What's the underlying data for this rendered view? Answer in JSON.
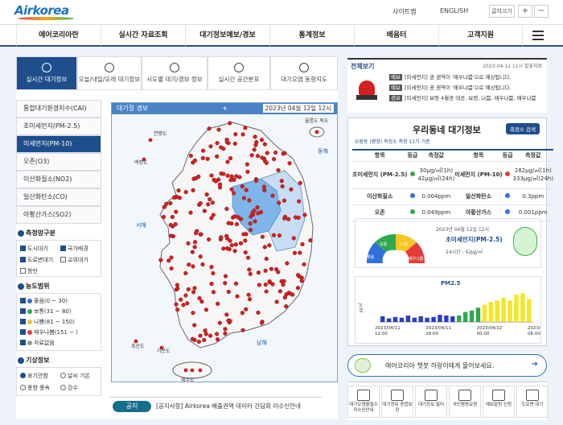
{
  "header": {
    "logo": "Airkorea",
    "sitemap": "사이트맵",
    "english": "ENGLISH",
    "font_size": "글자크기",
    "zoom_in": "+",
    "zoom_out": "−"
  },
  "nav": {
    "items": [
      "에어코리아란",
      "실시간 자료조회",
      "대기정보예보/경보",
      "통계정보",
      "배움터",
      "고객지원"
    ]
  },
  "tabs": [
    "실시간 대기정보",
    "오늘/내일/모레 대기정보",
    "시도별 대기/경보 정보",
    "실시간 공간분포",
    "대기오염 동향지도"
  ],
  "pollutants": [
    "통합대기환경지수(CAI)",
    "초미세먼지(PM-2.5)",
    "미세먼지(PM-10)",
    "오존(O3)",
    "이산화질소(NO2)",
    "일산화탄소(CO)",
    "아황산가스(SO2)"
  ],
  "pollutant_selected": 2,
  "station_type": {
    "title": "측정망구분",
    "items": [
      {
        "label": "도시대기",
        "checked": true
      },
      {
        "label": "국가배경",
        "checked": true
      },
      {
        "label": "도로변대기",
        "checked": true
      },
      {
        "label": "교외대기",
        "checked": false
      },
      {
        "label": "항만",
        "checked": false
      }
    ]
  },
  "concentration": {
    "title": "농도범위",
    "items": [
      {
        "label": "좋음(0 ~ 30)",
        "color": "#2f6fdc"
      },
      {
        "label": "보통(31 ~ 80)",
        "color": "#2fa84f"
      },
      {
        "label": "나쁨(81 ~ 150)",
        "color": "#f6c623"
      },
      {
        "label": "매우나쁨(151 ~ )",
        "color": "#e53b3b"
      },
      {
        "label": "자료없음",
        "color": "#999999"
      }
    ]
  },
  "weather": {
    "title": "기상정보",
    "items": [
      {
        "label": "표기안함",
        "checked": true
      },
      {
        "label": "날씨 기온",
        "checked": false
      },
      {
        "label": "풍향 풍속",
        "checked": false
      },
      {
        "label": "강수",
        "checked": false
      }
    ]
  },
  "map": {
    "title": "대기질 경보",
    "plus": "+",
    "datetime": "2023년 04월 12일 12시",
    "labels": {
      "yeonpyeong": "연평도",
      "baengnyeong": "백령도",
      "ulleung": "울릉도 독도",
      "donghae": "동해",
      "seohae": "서해",
      "namhae": "남해",
      "jeju": "제주도",
      "heuksan": "흑산도",
      "geomundo": "거문도"
    }
  },
  "notice": {
    "button": "공지",
    "text": "[공지사항]  Airkorea 배출권역 데이터 간담회 미수신안내"
  },
  "news": {
    "title": "전체보기",
    "time": "2023-04-12 11시 발표자료",
    "items": [
      {
        "tag": "예보",
        "text": "[미세먼지] 권 권역이 '매우나쁨'으로 예상됩니다."
      },
      {
        "tag": "예보",
        "text": "[미세먼지] 권 권역이 '매우나쁨'으로 예상됩니다."
      },
      {
        "tag": "경보",
        "text": "[미세먼지] 보령 4월경 대응, 보령, 나쁨, 매우나쁨, 매우나쁨"
      }
    ]
  },
  "local": {
    "title": "우리동네 대기정보",
    "title_accent": "대기정보",
    "button": "측정소 검색",
    "station": "요람동 (평창) 측정소 측정 11기 기준",
    "header": [
      "항목",
      "등급",
      "측정값",
      "항목",
      "등급",
      "측정값"
    ],
    "rows": [
      {
        "n1": "초미세먼지 (PM-2.5)",
        "v1": "30μg/㎥(1h)",
        "v1b": "42μg/㎥(24h)",
        "n2": "미세먼지 (PM-10)",
        "v2": "282μg/㎥(1h)",
        "v2b": "333μg/㎥(24h)"
      },
      {
        "n1": "이산화질소",
        "v1": "0.004ppm",
        "n2": "일산화탄소",
        "v2": "0.3ppm"
      },
      {
        "n1": "오존",
        "v1": "0.049ppm",
        "n2": "아황산가스",
        "v2": "0.001ppm"
      }
    ],
    "gauge_labels": [
      "좋음",
      "보통",
      "나쁨",
      "매우나쁨"
    ],
    "gauge_time": "2023년 04월 12일 12시",
    "gauge_item": "초미세먼지(PM-2.5)",
    "gauge_value": "24시간 : 42㎍/㎥"
  },
  "chart": {
    "title": "PM2.5",
    "ylabel": "㎍/㎥",
    "xlabels": [
      "2023/04/11\n12:00",
      "2023/04/11\n18:00",
      "2023/04/12\n00:00",
      "2023/04/12\n06:00"
    ]
  },
  "chart_data": {
    "type": "bar",
    "title": "PM2.5",
    "ylabel": "㎍/㎥",
    "categories": [
      "2023/04/11 12:00",
      "2023/04/11 18:00",
      "2023/04/12 00:00",
      "2023/04/12 06:00"
    ],
    "values": [
      8,
      5,
      7,
      6,
      9,
      6,
      8,
      6,
      7,
      10,
      9,
      8,
      9,
      14,
      16,
      20,
      24,
      28,
      30,
      34,
      30,
      38,
      40,
      32
    ],
    "colors": [
      "#2b3dc8",
      "#2b3dc8",
      "#2b3dc8",
      "#2b3dc8",
      "#2b3dc8",
      "#2b3dc8",
      "#2b3dc8",
      "#2b3dc8",
      "#2b3dc8",
      "#2b3dc8",
      "#2b3dc8",
      "#2b3dc8",
      "#2fa84f",
      "#2fa84f",
      "#2fa84f",
      "#2fa84f",
      "#f6e623",
      "#f6e623",
      "#f6e623",
      "#f6e623",
      "#f6e623",
      "#f6e623",
      "#f6e623",
      "#f6e623"
    ]
  },
  "chatbot": {
    "text": "에어코리아 챗봇 하랑이에게 물어보세요."
  },
  "quick": [
    "대기오염물질수 미수신안내",
    "대기정보 종합보장",
    "대기정보 필터",
    "국민행동요령",
    "예보알림 신청",
    "도로변 대기"
  ]
}
